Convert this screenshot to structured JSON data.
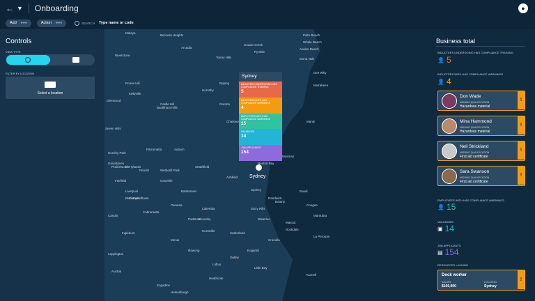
{
  "header": {
    "title": "Onboarding"
  },
  "subbar": {
    "add_label": "Add",
    "action_label": "Action",
    "search_label": "SEARCH",
    "search_placeholder": "Type name or code"
  },
  "controls": {
    "title": "Controls",
    "view_type_label": "VIEW TYPE",
    "filter_label": "FILTER BY LOCATION",
    "location_button": "Select a location"
  },
  "popup": {
    "title": "Sydney",
    "rows": [
      {
        "label": "INDUCTEES UNDERGOING H&S COMPLIANCE TRAINING",
        "value": "5",
        "color": "#e8684a"
      },
      {
        "label": "INDUCTEES WITH H&S COMPLIANCE WARNINGS",
        "value": "4",
        "color": "#f39c12"
      },
      {
        "label": "EMPLOYEES WITH H&S COMPLIANCE WARNINGS",
        "value": "15",
        "color": "#2ec4a0"
      },
      {
        "label": "VACANCIES",
        "value": "14",
        "color": "#23b5d3"
      },
      {
        "label": "JOB APPLICANTS",
        "value": "154",
        "color": "#8e6bdc"
      }
    ],
    "pin_label": "Sydney"
  },
  "map_labels": [
    "Malaya",
    "Berowra Heights",
    "Cowan Creek",
    "Palm Beach",
    "Whale Beach",
    "Avalon Beach",
    "Arcadia",
    "Mona Vale",
    "Terrey Hills",
    "Castle Hill",
    "Hornsby",
    "Gordon",
    "Chatswood",
    "Manly",
    "Parramatta",
    "Auburn",
    "Strathfield",
    "Ashfield",
    "Sydney",
    "Bondi",
    "Randwick",
    "Coogee",
    "Maroubra",
    "Botany",
    "Hurstville",
    "Cronulla",
    "Liverpool",
    "Bankstown",
    "Campbelltown",
    "Penrith",
    "Blacktown",
    "Wetherill Park",
    "Cabramatta",
    "Menai",
    "Engadine",
    "Helensburgh",
    "Mosman",
    "Neutral Bay",
    "Surry Hills",
    "Waterloo",
    "Mascot",
    "Sutherland",
    "Kellyville",
    "Baulkham Hills",
    "Epping",
    "Ryde",
    "Pymble",
    "Dee Why",
    "Narrabeen",
    "Rouse Hill",
    "Riverstone",
    "Glenwood",
    "Seven Hills",
    "Merrylands",
    "Granville",
    "Fairfield",
    "Lakemba",
    "Kogarah",
    "Oatley",
    "Rockdale",
    "La Perouse",
    "Kurnell",
    "Little Bay",
    "Loftus",
    "Heathcote",
    "Illawong",
    "Padstow",
    "Revesby",
    "Panania",
    "Casula",
    "Ingleburn",
    "Leppington",
    "Austral",
    "Horsley Park",
    "Prairiewood",
    "Greystanes"
  ],
  "business": {
    "title": "Business total",
    "training_label": "INDUCTEES UNDERGOING H&S COMPLIANCE TRAINING",
    "training_value": "5",
    "warnings_label": "INDUCTEES WITH H&S COMPLIANCE WARNINGS",
    "warnings_value": "4",
    "people": [
      {
        "name": "Don Wade",
        "mq_label": "MISSING QUALIFICATION",
        "qualification": "Hazardous material"
      },
      {
        "name": "Mina Hammond",
        "mq_label": "MISSING QUALIFICATION",
        "qualification": "Hazardous material"
      },
      {
        "name": "Nell Strickland",
        "mq_label": "MISSING QUALIFICATION",
        "qualification": "First aid certificate"
      },
      {
        "name": "Sara Swanson",
        "mq_label": "MISSING QUALIFICATION",
        "qualification": "First aid certificate"
      }
    ],
    "employees_label": "EMPLOYEES WITH H&S COMPLIANCE WARNINGS",
    "employees_value": "15",
    "vacancies_label": "VACANCIES",
    "vacancies_value": "14",
    "applicants_label": "JOB APPLICANTS",
    "applicants_value": "154",
    "resources_label": "RESOURCES LACKING",
    "resource": {
      "title": "Dock worker",
      "salary_label": "SALARY",
      "salary": "$100,000",
      "location_label": "LOCATION",
      "location": "Sydney"
    }
  },
  "colors": {
    "accent": "#23d5ef",
    "warning": "#f39c12",
    "training": "#e8684a",
    "employees": "#2ec4a0",
    "vacancies": "#23b5d3",
    "applicants": "#8e6bdc"
  }
}
